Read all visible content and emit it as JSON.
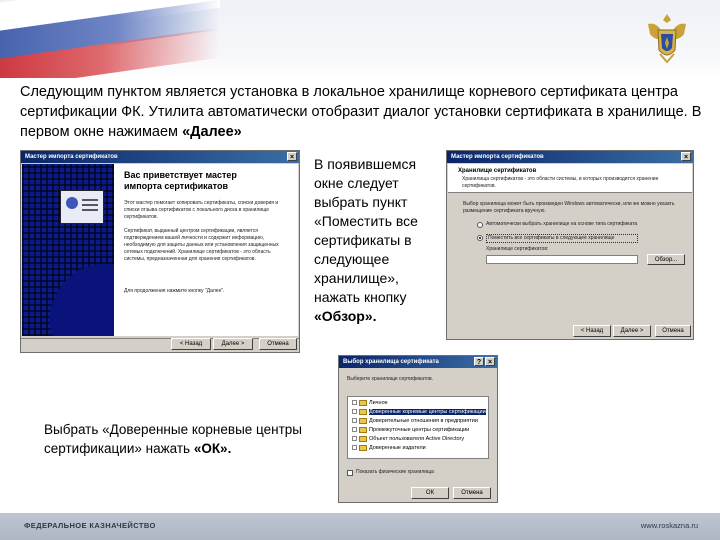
{
  "headline": {
    "text_before": "Следующим пунктом является установка в локальное хранилище корневого сертификата центра сертификации ФК.  Утилита автоматически отобразит диалог установки сертификата в хранилище. В первом окне нажимаем ",
    "bold": "«Далее»"
  },
  "side_note": {
    "text_before": "В появившемся окне следует выбрать пункт «Поместить все сертификаты в следующее хранилище», нажать кнопку ",
    "bold": "«Обзор»."
  },
  "bottom_note": {
    "text_before": "Выбрать «Доверенные корневые центры сертификации» нажать  ",
    "bold": "«ОК»."
  },
  "wizard1": {
    "title": "Мастер импорта сертификатов",
    "close_glyph": "×",
    "welcome_title": "Вас приветствует мастер импорта сертификатов",
    "para1": "Этот мастер помогает копировать сертификаты, списки доверия и списки отзыва сертификатов с локального диска в хранилище сертификатов.",
    "para2": "Сертификат, выданный центром сертификации, является подтверждением вашей личности и содержит информацию, необходимую для защиты данных или установления защищенных сетевых подключений. Хранилище сертификатов - это область системы, предназначенная для хранения сертификатов.",
    "para3": "Для продолжения нажмите кнопку \"Далее\".",
    "back_label": "< Назад",
    "next_label": "Далее >",
    "cancel_label": "Отмена"
  },
  "wizard2": {
    "title": "Мастер импорта сертификатов",
    "close_glyph": "×",
    "section_title": "Хранилище сертификатов",
    "section_desc": "Хранилища сертификатов - это области системы, в которых производится хранение сертификатов.",
    "instruction": "Выбор хранилища может быть произведен Windows автоматически, или же можно указать размещение сертификата вручную.",
    "radio_auto": "Автоматически выбрать хранилище на основе типа сертификата",
    "radio_manual": "Поместить все сертификаты в следующее хранилище",
    "store_label": "Хранилище сертификатов:",
    "browse_label": "Обзор...",
    "back_label": "< Назад",
    "next_label": "Далее >",
    "cancel_label": "Отмена"
  },
  "dialog3": {
    "title": "Выбор хранилища сертификата",
    "help_glyph": "?",
    "close_glyph": "×",
    "prompt": "Выберите хранилище сертификатов.",
    "items": [
      {
        "label": "Личное",
        "selected": false
      },
      {
        "label": "Доверенные корневые центры сертификации",
        "selected": true
      },
      {
        "label": "Доверительные отношения в предприятии",
        "selected": false
      },
      {
        "label": "Промежуточные центры сертификации",
        "selected": false
      },
      {
        "label": "Объект пользователя Active Directory",
        "selected": false
      },
      {
        "label": "Доверенные издатели",
        "selected": false
      }
    ],
    "show_physical": "Показать физические хранилища",
    "ok_label": "ОК",
    "cancel_label": "Отмена"
  },
  "footer": {
    "left": "ФЕДЕРАЛЬНОЕ КАЗНАЧЕЙСТВО",
    "right": "www.roskazna.ru"
  },
  "colors": {
    "titlebar": "#0a246a",
    "window_bg": "#d4d0c8",
    "wizard_side": "#0b1a8c",
    "flag_blue": "#3a57a5",
    "flag_red": "#c7262e",
    "emblem_gold": "#c9a23a",
    "footer_bg": "#aeb6c4"
  },
  "icons": [
    "emblem-icon",
    "certificate-icon",
    "folder-icon"
  ]
}
